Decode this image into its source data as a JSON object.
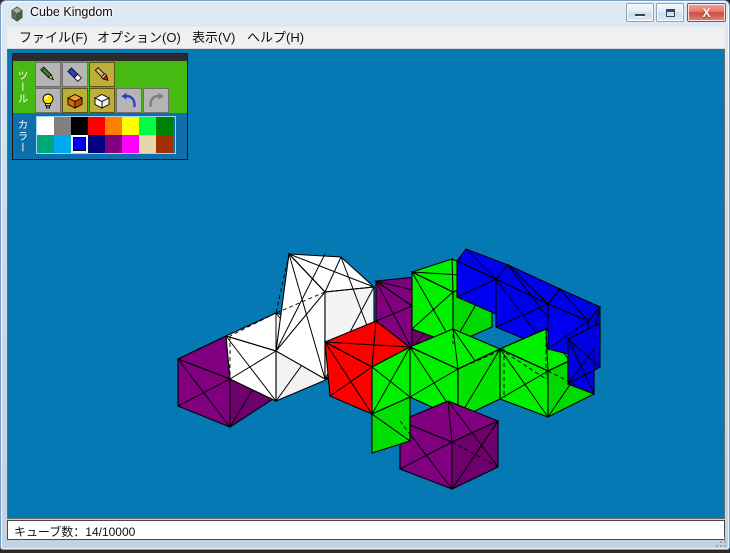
{
  "window": {
    "title": "Cube Kingdom",
    "icon": "app-cube-icon",
    "controls": {
      "minimize": "–",
      "maximize": "□",
      "close": "X"
    }
  },
  "menu": {
    "items": [
      {
        "label": "ファイル(F)",
        "name": "menu-file"
      },
      {
        "label": "オプション(O)",
        "name": "menu-options"
      },
      {
        "label": "表示(V)",
        "name": "menu-view"
      },
      {
        "label": "ヘルプ(H)",
        "name": "menu-help"
      }
    ]
  },
  "panel": {
    "tool_section_label": "ツール",
    "color_section_label": "カラー",
    "tools": [
      {
        "name": "pencil-tool",
        "icon": "pencil-icon",
        "selected": false
      },
      {
        "name": "eraser-tool",
        "icon": "eraser-icon",
        "selected": false
      },
      {
        "name": "brush-tool",
        "icon": "paintbrush-icon",
        "selected": true
      },
      {
        "name": "light-tool",
        "icon": "lightbulb-icon",
        "selected": false
      },
      {
        "name": "solid-cube-tool",
        "icon": "solid-cube-icon",
        "selected": true
      },
      {
        "name": "wireframe-cube-tool",
        "icon": "wireframe-cube-icon",
        "selected": true
      },
      {
        "name": "undo-button",
        "icon": "undo-arrow-icon",
        "selected": false
      },
      {
        "name": "redo-button",
        "icon": "redo-arrow-icon",
        "selected": false
      }
    ],
    "palette": {
      "row1": [
        "#ffffff",
        "#808080",
        "#000000",
        "#ff0000",
        "#ff8000",
        "#ffff00",
        "#00ff40",
        "#008000"
      ],
      "row2": [
        "#00a878",
        "#00a8f0",
        "#0000ff",
        "#000080",
        "#800080",
        "#ff00ff",
        "#e8d4aa",
        "#a03000"
      ],
      "selected_index": 10,
      "selected_color": "#0000ff"
    }
  },
  "canvas": {
    "background_color": "#0479b4",
    "cube_count_current": 14,
    "cube_count_max": 10000,
    "cube_colors": {
      "white": "#ffffff",
      "red": "#ff0000",
      "green": "#00f000",
      "blue": "#0000f0",
      "purple": "#800080"
    }
  },
  "statusbar": {
    "text": "キューブ数：14/10000"
  }
}
